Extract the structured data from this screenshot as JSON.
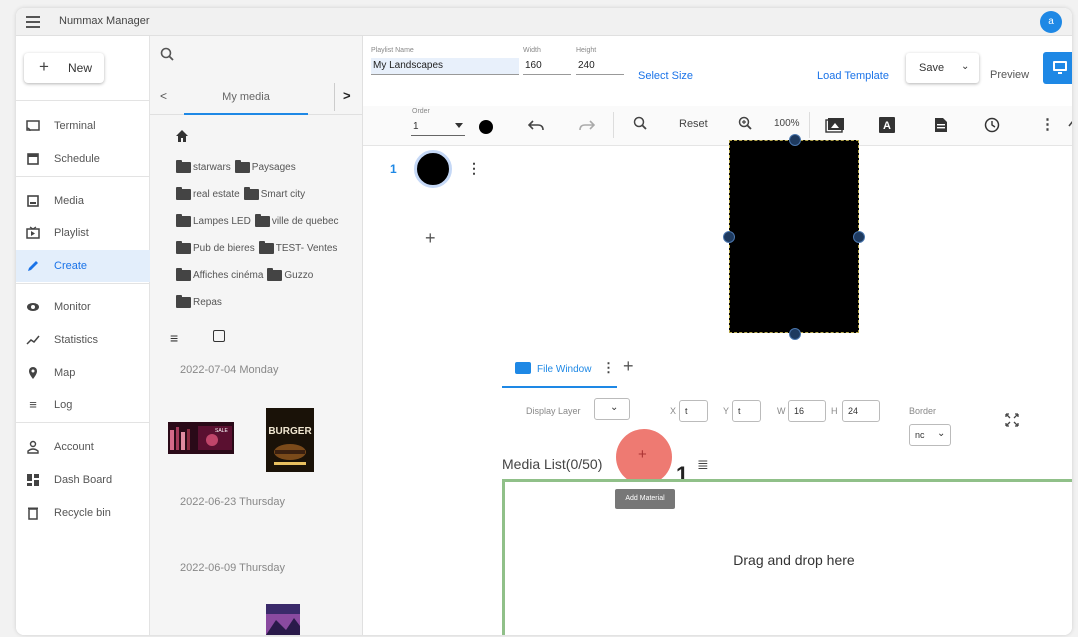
{
  "app": {
    "title": "Nummax Manager",
    "avatar_initial": "a"
  },
  "nav": {
    "new_label": "New",
    "items": [
      {
        "label": "Terminal",
        "icon": "cast-icon"
      },
      {
        "label": "Schedule",
        "icon": "calendar-icon"
      },
      {
        "label": "Media",
        "icon": "media-icon"
      },
      {
        "label": "Playlist",
        "icon": "playlist-icon"
      },
      {
        "label": "Create",
        "icon": "pencil-icon",
        "active": true
      },
      {
        "label": "Monitor",
        "icon": "eye-icon"
      },
      {
        "label": "Statistics",
        "icon": "chart-icon"
      },
      {
        "label": "Map",
        "icon": "map-pin-icon"
      },
      {
        "label": "Log",
        "icon": "list-icon"
      },
      {
        "label": "Account",
        "icon": "person-icon"
      },
      {
        "label": "Dash Board",
        "icon": "dashboard-icon"
      },
      {
        "label": "Recycle bin",
        "icon": "trash-icon"
      }
    ]
  },
  "media_panel": {
    "tab_label": "My media",
    "folders": [
      [
        "starwars",
        "Paysages"
      ],
      [
        "real estate",
        "Smart city"
      ],
      [
        "Lampes LED",
        "ville de quebec"
      ],
      [
        "Pub de bieres",
        "TEST- Ventes"
      ],
      [
        "Affiches cinéma",
        "Guzzo"
      ],
      [
        "Repas"
      ]
    ],
    "dates": [
      "2022-07-04 Monday",
      "2022-06-23 Thursday",
      "2022-06-09 Thursday"
    ],
    "burger_thumb_text": "BURGER",
    "sale_thumb_text": "SALE"
  },
  "editor": {
    "playlist_name_label": "Playlist Name",
    "playlist_name": "My Landscapes",
    "width_label": "Width",
    "width": "160",
    "height_label": "Height",
    "height": "240",
    "select_size": "Select Size",
    "load_template": "Load Template",
    "save": "Save",
    "preview": "Preview",
    "order_label": "Order",
    "order_value": "1",
    "reset": "Reset",
    "zoom": "100%",
    "layer_number": "1",
    "window_tab": "File Window",
    "display_layer_label": "Display Layer",
    "x_label": "X",
    "x_value": "t",
    "y_label": "Y",
    "y_value": "t",
    "w_label": "W",
    "w_value": "16",
    "h_label": "H",
    "h_value": "24",
    "border_label": "Border",
    "border_value": "nc",
    "media_list_title": "Media List(0/50)",
    "add_material_tooltip": "Add Material",
    "step_number": "1",
    "dropzone_text": "Drag and drop here"
  },
  "colors": {
    "accent": "#1e88e5",
    "active_bg": "#e3eefb",
    "dropzone_border": "#90c089",
    "highlight": "#ee7a72"
  }
}
